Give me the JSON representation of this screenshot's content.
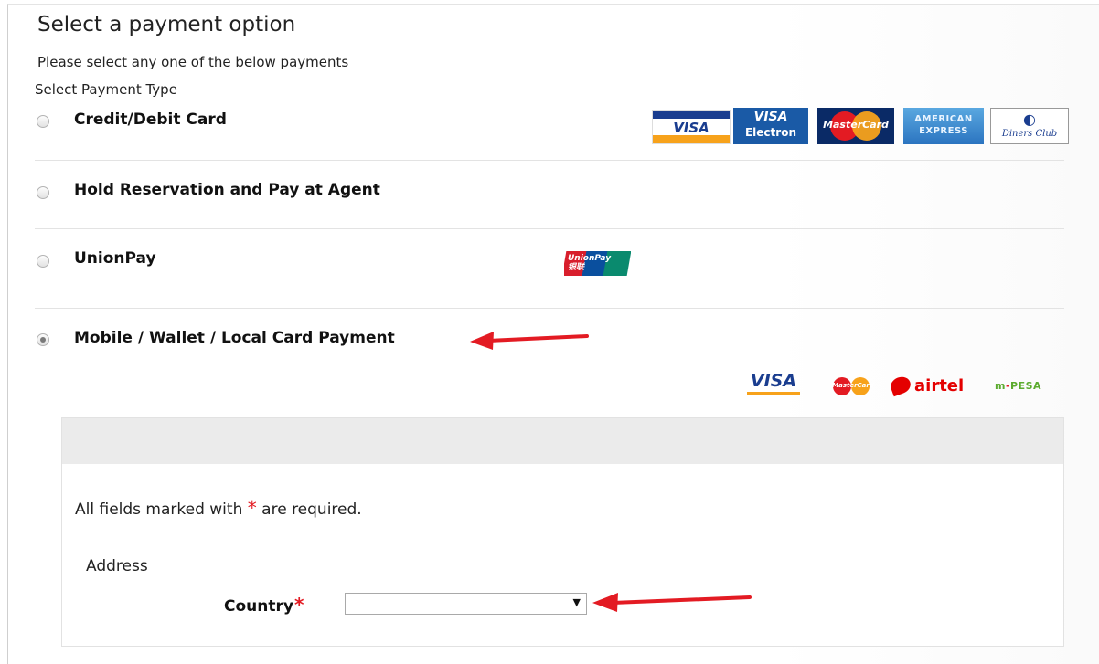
{
  "page": {
    "title": "Select a payment option",
    "subtitle": "Please select any one of the below payments",
    "type_label": "Select Payment Type"
  },
  "options": [
    {
      "label": "Credit/Debit Card",
      "selected": false
    },
    {
      "label": "Hold Reservation and Pay at Agent",
      "selected": false
    },
    {
      "label": "UnionPay",
      "selected": false
    },
    {
      "label": "Mobile / Wallet / Local Card Payment",
      "selected": true
    }
  ],
  "card_logos": {
    "visa": "VISA",
    "visa_electron_top": "VISA",
    "visa_electron_bottom": "Electron",
    "mastercard": "MasterCard",
    "amex_line1": "AMERICAN",
    "amex_line2": "EXPRESS",
    "diners_symbol": "◐",
    "diners": "Diners Club",
    "unionpay_line1": "UnionPay",
    "unionpay_line2": "银联"
  },
  "mobile_logos": {
    "visa": "VISA",
    "mastercard": "MasterCard",
    "airtel": "airtel",
    "mpesa_m": "m",
    "mpesa_dash": "-",
    "mpesa_rest": "PESA"
  },
  "form": {
    "required_prefix": "All fields marked with",
    "required_star": "*",
    "required_suffix": "are required.",
    "address_label": "Address",
    "country_label": "Country",
    "country_star": "*",
    "country_value": "",
    "dropdown_arrow": "▼"
  },
  "colors": {
    "annotation_red": "#e31b23",
    "visa_blue": "#1a3d8f",
    "mastercard_red": "#e31b23",
    "mastercard_orange": "#f7a21b",
    "airtel_red": "#e40000",
    "mpesa_green": "#5bab2e"
  }
}
